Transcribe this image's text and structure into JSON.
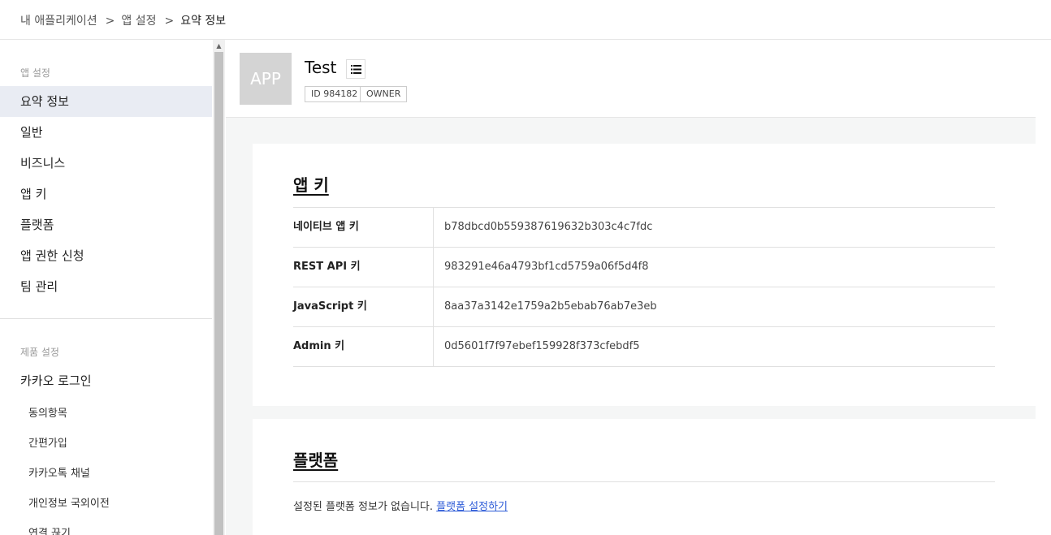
{
  "breadcrumb": {
    "items": [
      "내 애플리케이션",
      "앱 설정"
    ],
    "current": "요약 정보",
    "separator": ">"
  },
  "sidebar": {
    "section_app_label": "앱 설정",
    "app_items": [
      {
        "label": "요약 정보",
        "active": true
      },
      {
        "label": "일반"
      },
      {
        "label": "비즈니스"
      },
      {
        "label": "앱 키"
      },
      {
        "label": "플랫폼"
      },
      {
        "label": "앱 권한 신청"
      },
      {
        "label": "팀 관리"
      }
    ],
    "section_product_label": "제품 설정",
    "product_item": "카카오 로그인",
    "product_sub_items": [
      "동의항목",
      "간편가입",
      "카카오톡 채널",
      "개인정보 국외이전",
      "연결 끊기"
    ]
  },
  "app": {
    "thumb_text": "APP",
    "name": "Test",
    "list_icon": "list-icon",
    "id_badge": "ID 984182",
    "role_badge": "OWNER"
  },
  "app_keys": {
    "title": "앱 키",
    "rows": [
      {
        "label": "네이티브 앱 키",
        "value": "b78dbcd0b559387619632b303c4c7fdc"
      },
      {
        "label": "REST API 키",
        "value": "983291e46a4793bf1cd5759a06f5d4f8"
      },
      {
        "label": "JavaScript 키",
        "value": "8aa37a3142e1759a2b5ebab76ab7e3eb"
      },
      {
        "label": "Admin 키",
        "value": "0d5601f7f97ebef159928f373cfebdf5"
      }
    ]
  },
  "platform": {
    "title": "플랫폼",
    "message": "설정된 플랫폼 정보가 없습니다.",
    "link_label": "플랫폼 설정하기"
  },
  "colors": {
    "active_bg": "#e9ecf3",
    "link": "#2d5bd7",
    "main_bg": "#f5f6f6"
  }
}
